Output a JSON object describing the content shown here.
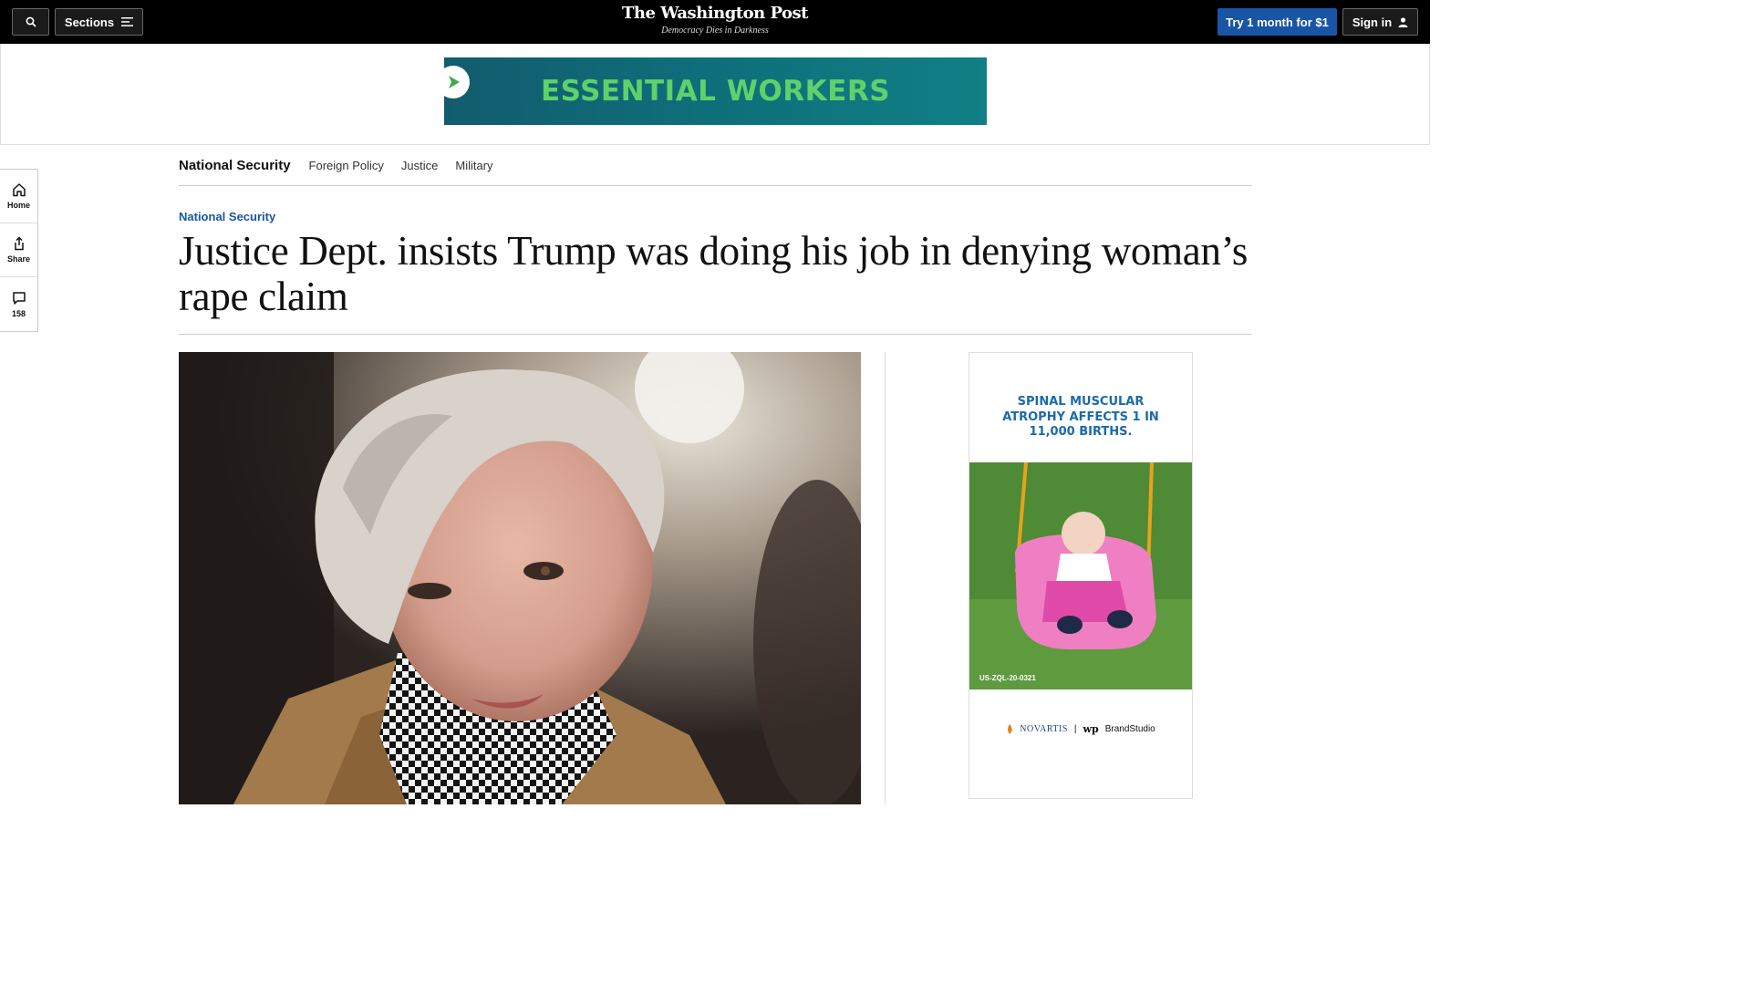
{
  "header": {
    "sections_label": "Sections",
    "logo_name": "The Washington Post",
    "logo_tagline": "Democracy Dies in Darkness",
    "subscribe_label": "Try 1 month for $1",
    "signin_label": "Sign in"
  },
  "top_ad": {
    "text": "ESSENTIAL WORKERS"
  },
  "section_nav": {
    "primary": "National Security",
    "items": [
      "Foreign Policy",
      "Justice",
      "Military"
    ]
  },
  "left_rail": {
    "home_label": "Home",
    "share_label": "Share",
    "comments_count": "158"
  },
  "article": {
    "kicker": "National Security",
    "headline": "Justice Dept. insists Trump was doing his job in denying woman’s rape claim"
  },
  "side_ad": {
    "headline_line1": "SPINAL MUSCULAR",
    "headline_line2": "ATROPHY AFFECTS 1 IN",
    "headline_line3": "11,000 BIRTHS.",
    "code": "US-ZQL-20-0321",
    "sponsor": "NOVARTIS",
    "studio_logo": "wp",
    "studio": "BrandStudio"
  },
  "colors": {
    "topbar": "#000000",
    "accent_blue": "#1955a5",
    "banner_green": "#5fd16a",
    "banner_teal": "#0e6f7a"
  }
}
